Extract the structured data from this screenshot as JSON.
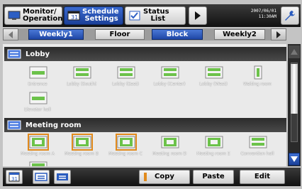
{
  "topbar": {
    "monitor_label": "Monitor/\nOperation",
    "schedule_label": "Schedule\n Settings",
    "status_label": "Status\n   List",
    "date": "2007/06/01",
    "time": "11:30AM"
  },
  "tabs": [
    {
      "label": "Weekly1",
      "active": true
    },
    {
      "label": "Floor",
      "active": false
    },
    {
      "label": "Block",
      "active": true
    },
    {
      "label": "Weekly2",
      "active": false
    }
  ],
  "groups": [
    {
      "name": "Lobby",
      "units": [
        {
          "label": "Entrance",
          "selected": false
        },
        {
          "label": "Lobby (South)",
          "selected": false
        },
        {
          "label": "Lobby (East)",
          "selected": false
        },
        {
          "label": "Lobby (Center)",
          "selected": false
        },
        {
          "label": "Lobby (West)",
          "selected": false
        },
        {
          "label": "Waiting room",
          "selected": false
        },
        {
          "label": "Elevator hall",
          "selected": false
        }
      ]
    },
    {
      "name": "Meeting room",
      "units": [
        {
          "label": "Meeting room A",
          "selected": true
        },
        {
          "label": "Meeting room B",
          "selected": true
        },
        {
          "label": "Meeting room C",
          "selected": true
        },
        {
          "label": "Meeting room D",
          "selected": false
        },
        {
          "label": "Meeting room E",
          "selected": false
        },
        {
          "label": "Convention hall",
          "selected": false
        }
      ]
    }
  ],
  "bottombar": {
    "copy_label": "Copy",
    "paste_label": "Paste",
    "edit_label": "Edit"
  },
  "colors": {
    "accent_blue": "#1f47a6",
    "selection_orange": "#e18a1c",
    "unit_green": "#6cc24a"
  }
}
